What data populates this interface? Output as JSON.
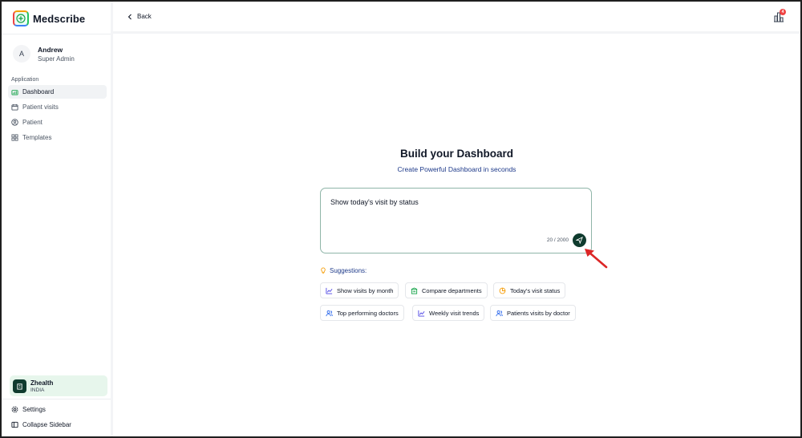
{
  "app": {
    "name": "Medscribe"
  },
  "user": {
    "initial": "A",
    "name": "Andrew",
    "role": "Super Admin"
  },
  "sidebar": {
    "section_label": "Application",
    "items": [
      {
        "label": "Dashboard",
        "icon": "dashboard-icon",
        "active": true
      },
      {
        "label": "Patient visits",
        "icon": "calendar-icon",
        "active": false
      },
      {
        "label": "Patient",
        "icon": "user-circle-icon",
        "active": false
      },
      {
        "label": "Templates",
        "icon": "grid-icon",
        "active": false
      }
    ],
    "org": {
      "name": "Zhealth",
      "country": "INDIA"
    },
    "settings_label": "Settings",
    "collapse_label": "Collapse Sidebar"
  },
  "header": {
    "back_label": "Back",
    "badge_count": "4"
  },
  "main": {
    "title": "Build your Dashboard",
    "subtitle": "Create Powerful Dashboard in seconds",
    "prompt_value": "Show today's visit by status",
    "counter": "20 / 2000",
    "suggestions_label": "Suggestions:",
    "suggestions": [
      {
        "label": "Show visits by month",
        "icon": "line-chart-icon",
        "color": "#4f46e5"
      },
      {
        "label": "Compare departments",
        "icon": "building-icon",
        "color": "#16a34a"
      },
      {
        "label": "Today's visit status",
        "icon": "pie-chart-icon",
        "color": "#f59e0b"
      },
      {
        "label": "Top performing doctors",
        "icon": "users-icon",
        "color": "#2563eb"
      },
      {
        "label": "Weekly visit trends",
        "icon": "line-chart-icon",
        "color": "#4f46e5"
      },
      {
        "label": "Patients visits by doctor",
        "icon": "users-icon",
        "color": "#2563eb"
      }
    ]
  },
  "colors": {
    "accent": "#0f3b2e",
    "active_bg": "#f1f3f5",
    "org_bg": "#e7f6ec",
    "annotation": "#dc2626"
  }
}
